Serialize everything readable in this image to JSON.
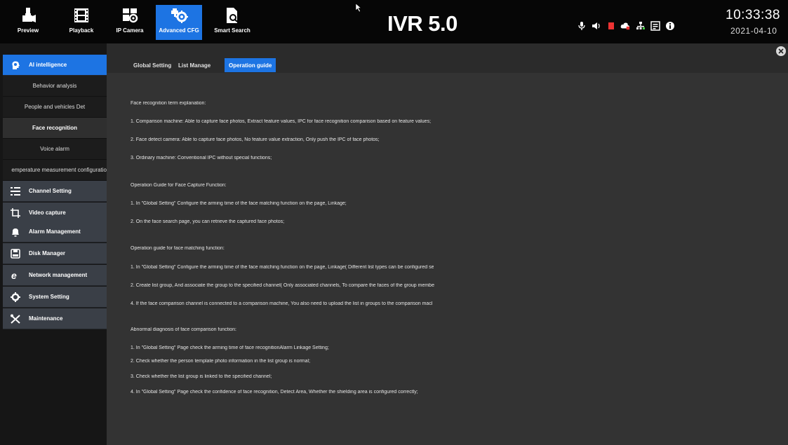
{
  "topbar": {
    "nav": [
      {
        "label": "Preview"
      },
      {
        "label": "Playback"
      },
      {
        "label": "IP Camera"
      },
      {
        "label": "Advanced CFG"
      },
      {
        "label": "Smart Search"
      }
    ],
    "brand": "IVR 5.0",
    "time": "10:33:38",
    "date": "2021-04-10",
    "status_icons": [
      "microphone-icon",
      "speaker-icon",
      "record-icon",
      "cloud-icon",
      "network-icon",
      "storage-icon",
      "info-icon"
    ]
  },
  "sidebar": {
    "items": [
      {
        "label": "AI intelligence",
        "icon": "ai-head-icon"
      },
      {
        "label": "Channel Setting",
        "icon": "channel-list-icon"
      },
      {
        "label": "Video capture",
        "icon": "crop-icon"
      },
      {
        "label": "Alarm Management",
        "icon": "bell-icon"
      },
      {
        "label": "Disk Manager",
        "icon": "disk-icon"
      },
      {
        "label": "Network management",
        "icon": "network-e-icon"
      },
      {
        "label": "System Setting",
        "icon": "gear-icon"
      },
      {
        "label": "Maintenance",
        "icon": "tools-icon"
      }
    ],
    "subitems": [
      {
        "label": "Behavior analysis"
      },
      {
        "label": "People and vehicles Det"
      },
      {
        "label": "Face recognition"
      },
      {
        "label": "Voice alarm"
      },
      {
        "label": "emperature measurement configuratio"
      }
    ]
  },
  "tabs": [
    {
      "label": "Global Setting"
    },
    {
      "label": "List Manage"
    },
    {
      "label": "Operation guide"
    }
  ],
  "guide": {
    "lines": [
      "Face recognition term explanation:",
      "1. Comparison machine: Able to capture face photos, Extract feature values, IPC for face recognition comparison based on feature values;",
      "2. Face detect camera: Able to capture face photos, No feature value extraction, Only push the IPC of face photos;",
      "3. Ordinary machine: Conventional IPC without special functions;",
      "Operation Guide for Face Capture Function:",
      "1. In \"Global Setting\" Configure the arming time of the face matching function on the page, Linkage;",
      "2. On the face search page, you can retrieve the captured face photos;",
      "Operation guide for face matching function:",
      "1. In \"Global Setting\" Configure the arming time of the face matching function on the page, Linkage( Different list types can be configured se",
      "2. Create list group, And associate the group to the specified channel( Only associated channels, To compare the faces of the group membe",
      "4. If the face comparison channel is connected to a comparison machine, You also need to upload the list in groups to the comparison macl",
      "Abnormal diagnosis of face comparison function:",
      "1. In \"Global Setting\" Page check the arming time of face recognitionAlarm Linkage Setting;",
      "2. Check whether the person template photo information in the list group is normal;",
      "3. Check whether the list group is linked to the specified channel;",
      "4. In \"Global Setting\" Page check the confidence of face recognition, Detect Area, Whether the shielding area is configured correctly;"
    ]
  },
  "colors": {
    "accent": "#1d74e3",
    "panel": "#333333",
    "sidebar_item": "#3a3f47"
  }
}
